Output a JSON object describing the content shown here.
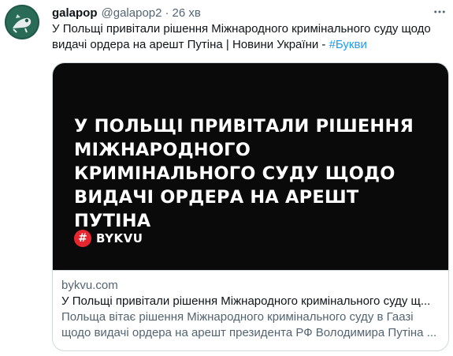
{
  "author": {
    "name": "galapop",
    "handle": "@galapop2",
    "separator": "·",
    "time": "26 хв"
  },
  "tweet": {
    "text": "У Польщі привітали рішення Міжнародного кримінального суду щодо видачі ордера на арешт Путіна | Новини України - ",
    "hashtag": "#Букви"
  },
  "card": {
    "image": {
      "headline": "У ПОЛЬЩІ ПРИВІТАЛИ РІШЕННЯ МІЖНАРОДНОГО КРИМІНАЛЬНОГО СУДУ ЩОДО ВИДАЧІ ОРДЕРА НА АРЕШТ ПУТІНА",
      "brand_symbol": "#",
      "brand_name": "BYKVU"
    },
    "domain": "bykvu.com",
    "title": "У Польщі привітали рішення Міжнародного кримінального суду щ...",
    "description_line1": "Польща вітає рішення Міжнародного кримінального суду в Гаазі",
    "description_line2": "щодо видачі ордера на арешт президента РФ Володимира Путіна ..."
  },
  "icons": {
    "more": "more-horizontal-icon",
    "avatar": "avatar-image"
  },
  "colors": {
    "accent": "#1d9bf0",
    "secondary_text": "#536471",
    "card_image_bg": "#0a0a0a",
    "brand_red": "#e8262e"
  }
}
